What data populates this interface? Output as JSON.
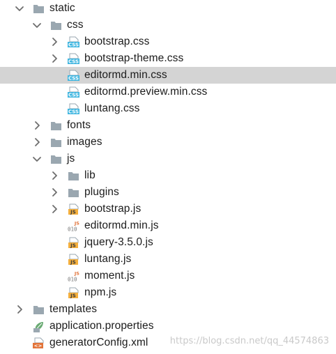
{
  "tree": [
    {
      "label": "static",
      "type": "folder",
      "level": 1,
      "expand": "expanded",
      "icon_name": "folder-icon"
    },
    {
      "label": "css",
      "type": "folder",
      "level": 2,
      "expand": "expanded",
      "icon_name": "folder-icon"
    },
    {
      "label": "bootstrap.css",
      "type": "css",
      "level": 3,
      "expand": "collapsed",
      "icon_name": "css-file-icon"
    },
    {
      "label": "bootstrap-theme.css",
      "type": "css",
      "level": 3,
      "expand": "collapsed",
      "icon_name": "css-file-icon"
    },
    {
      "label": "editormd.min.css",
      "type": "css",
      "level": 3,
      "expand": "none",
      "icon_name": "css-file-icon",
      "selected": true
    },
    {
      "label": "editormd.preview.min.css",
      "type": "css",
      "level": 3,
      "expand": "none",
      "icon_name": "css-file-icon"
    },
    {
      "label": "luntang.css",
      "type": "css",
      "level": 3,
      "expand": "none",
      "icon_name": "css-file-icon"
    },
    {
      "label": "fonts",
      "type": "folder",
      "level": 2,
      "expand": "collapsed",
      "icon_name": "folder-icon"
    },
    {
      "label": "images",
      "type": "folder",
      "level": 2,
      "expand": "collapsed",
      "icon_name": "folder-icon"
    },
    {
      "label": "js",
      "type": "folder",
      "level": 2,
      "expand": "expanded",
      "icon_name": "folder-icon"
    },
    {
      "label": "lib",
      "type": "folder",
      "level": 3,
      "expand": "collapsed",
      "icon_name": "folder-icon"
    },
    {
      "label": "plugins",
      "type": "folder",
      "level": 3,
      "expand": "collapsed",
      "icon_name": "folder-icon"
    },
    {
      "label": "bootstrap.js",
      "type": "js",
      "level": 3,
      "expand": "collapsed",
      "icon_name": "js-file-icon"
    },
    {
      "label": "editormd.min.js",
      "type": "minjs",
      "level": 3,
      "expand": "none",
      "icon_name": "minified-js-file-icon"
    },
    {
      "label": "jquery-3.5.0.js",
      "type": "js",
      "level": 3,
      "expand": "none",
      "icon_name": "js-file-icon"
    },
    {
      "label": "luntang.js",
      "type": "js",
      "level": 3,
      "expand": "none",
      "icon_name": "js-file-icon"
    },
    {
      "label": "moment.js",
      "type": "minjs",
      "level": 3,
      "expand": "none",
      "icon_name": "minified-js-file-icon"
    },
    {
      "label": "npm.js",
      "type": "js",
      "level": 3,
      "expand": "none",
      "icon_name": "js-file-icon"
    },
    {
      "label": "templates",
      "type": "folder",
      "level": 1,
      "expand": "collapsed",
      "icon_name": "folder-icon"
    },
    {
      "label": "application.properties",
      "type": "properties",
      "level": 1,
      "expand": "none",
      "icon_name": "spring-properties-icon"
    },
    {
      "label": "generatorConfig.xml",
      "type": "xml",
      "level": 1,
      "expand": "none",
      "icon_name": "xml-file-icon"
    }
  ],
  "icon_texts": {
    "css": "CSS",
    "js": "JS",
    "minjs_top": "JS",
    "minjs_bits": "010",
    "xml": "<>"
  },
  "colors": {
    "selected_bg": "#d4d4d4",
    "folder": "#9aa7b0",
    "css_badge": "#40b6e0",
    "js_badge": "#f4af3d",
    "min_js_accent": "#e2743a",
    "properties_leaf": "#6aab73",
    "xml_badge": "#e2743a",
    "chevron": "#6e6e6e",
    "text": "#1b1b1b"
  },
  "watermark": "https://blog.csdn.net/qq_44574863"
}
